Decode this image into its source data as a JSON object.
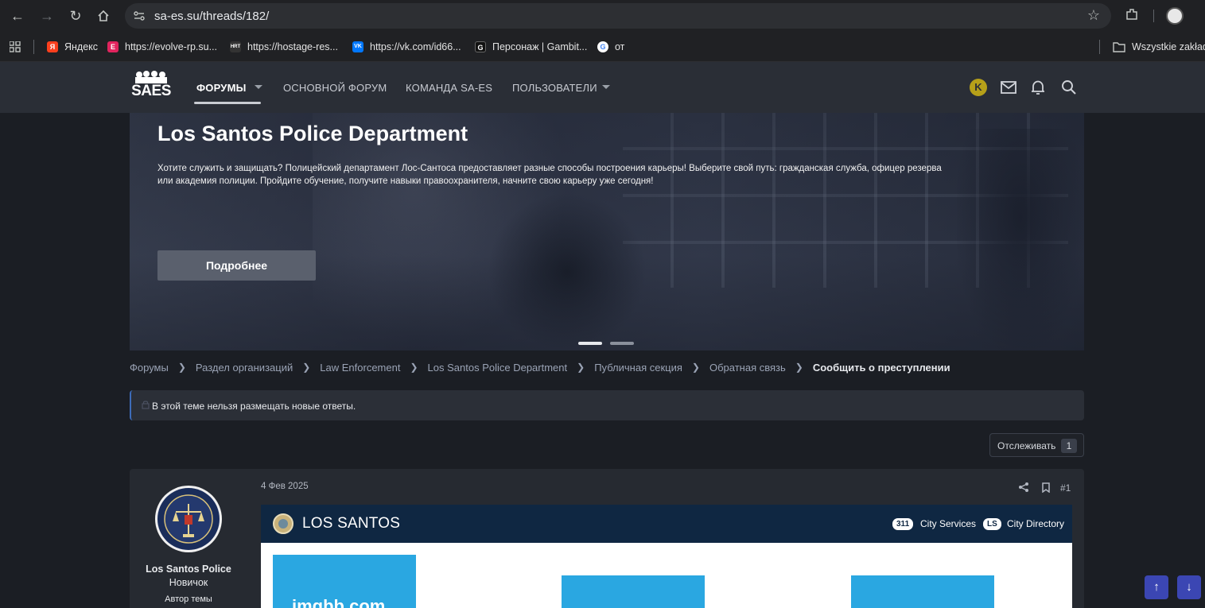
{
  "browser": {
    "url": "sa-es.su/threads/182/",
    "bookmarks": [
      {
        "label": "Яндекс",
        "color": "#fc3f1d",
        "glyph": "Я"
      },
      {
        "label": "https://evolve-rp.su...",
        "color": "#e0245e",
        "glyph": "E"
      },
      {
        "label": "https://hostage-res...",
        "color": "#333333",
        "glyph": "HRT"
      },
      {
        "label": "https://vk.com/id66...",
        "color": "#0077ff",
        "glyph": "VK"
      },
      {
        "label": "Персонаж | Gambit...",
        "color": "#111111",
        "glyph": "G"
      },
      {
        "label": "от",
        "color": "#ffffff",
        "glyph": "G"
      }
    ],
    "all_bookmarks": "Wszystkie zakładki"
  },
  "site": {
    "logo_text": "SAES",
    "nav": {
      "forums": "ФОРУМЫ",
      "main_forum": "ОСНОВНОЙ ФОРУМ",
      "team": "КОМАНДА SA-ES",
      "users": "ПОЛЬЗОВАТЕЛИ"
    },
    "avatar_letter": "K"
  },
  "hero": {
    "title": "Los Santos Police Department",
    "description": "Хотите служить и защищать? Полицейский департамент Лос-Сантоса предоставляет разные способы построения карьеры! Выберите свой путь: гражданская служба, офицер резерва или академия полиции. Пройдите обучение, получите навыки правоохранителя, начните свою карьеру уже сегодня!",
    "button": "Подробнее"
  },
  "breadcrumb": {
    "items": [
      "Форумы",
      "Раздел организаций",
      "Law Enforcement",
      "Los Santos Police Department",
      "Публичная секция",
      "Обратная связь"
    ],
    "current": "Сообщить о преступлении"
  },
  "notice": {
    "text": "В этой теме нельзя размещать новые ответы."
  },
  "watch": {
    "label": "Отслеживать",
    "count": "1"
  },
  "post": {
    "username": "Los Santos Police",
    "rank": "Новичок",
    "author_label": "Автор темы",
    "date": "4 Фев 2025",
    "number": "#1",
    "embed": {
      "title": "LOS SANTOS",
      "pill1": "311",
      "pill1_label": "City Services",
      "pill2": "LS",
      "pill2_label": "City Directory",
      "imgbb": "imgbb.com"
    }
  },
  "colors": {
    "header_bg": "#2a2e36",
    "page_bg": "#1b1e24",
    "accent_blue": "#3b46b3",
    "embed_header": "#0f2742",
    "image_placeholder": "#2aa7e1"
  }
}
